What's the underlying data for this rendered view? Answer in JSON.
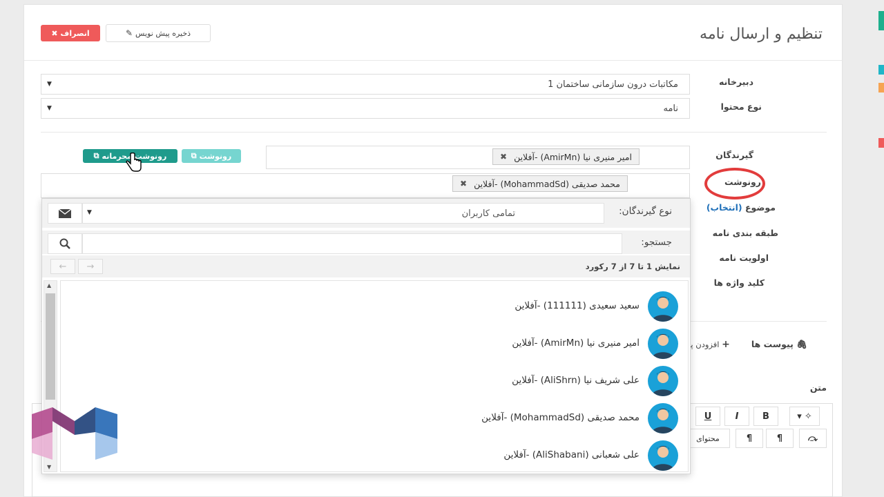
{
  "header": {
    "title": "تنظیم و ارسال نامه",
    "cancel_label": "انصراف",
    "draft_label": "ذخیره پیش نویس"
  },
  "form": {
    "secretariat_label": "دبیرخانه",
    "secretariat_value": "مکاتبات درون سازمانی ساختمان 1",
    "content_type_label": "نوع محتوا",
    "content_type_value": "نامه",
    "recipients_label": "گیرندگان",
    "recipient_tag": "امیر منیری نیا (AmirMn) -آفلاین",
    "cc_label": "رونوشت",
    "cc_tag": "محمد صدیقی (MohammadSd) -آفلاین",
    "cc_button": "رونوشت",
    "bcc_button": "رونوشت محرمانه",
    "subject_label": "موضوع",
    "subject_select": "(انتخاب)",
    "category_label": "طبقه بندی نامه",
    "priority_label": "اولویت نامه",
    "keywords_label": "کلید واژه ها",
    "attachments_label": "پیوست ها",
    "add_attachment_label": "افزودن پیو",
    "text_label": "متن",
    "editor_content_label": "محتوای"
  },
  "dropdown": {
    "recipient_type_label": "نوع گیرندگان:",
    "recipient_type_value": "تمامی کاربران",
    "search_label": "جستجو:",
    "search_value": "",
    "records_info": "نمایش 1 تا 7 از 7 رکورد",
    "users": [
      {
        "name": "سعید سعیدی (111111) -آفلاین"
      },
      {
        "name": "امیر منیری نیا (AmirMn) -آفلاین"
      },
      {
        "name": "علی شریف نیا (AliShrn) -آفلاین"
      },
      {
        "name": "محمد صدیقی (MohammadSd) -آفلاین"
      },
      {
        "name": "علی شعبانی (AliShabani) -آفلاین"
      }
    ]
  },
  "toolbar": {
    "bold": "B",
    "italic": "I",
    "underline": "U"
  },
  "colors": {
    "danger": "#ef5a5a",
    "teal_light": "#76d5d0",
    "teal_dark": "#1f9b8c",
    "highlight_circle": "#e23c3c",
    "avatar_bg": "#1aa1d8",
    "link": "#1e6fb8"
  }
}
